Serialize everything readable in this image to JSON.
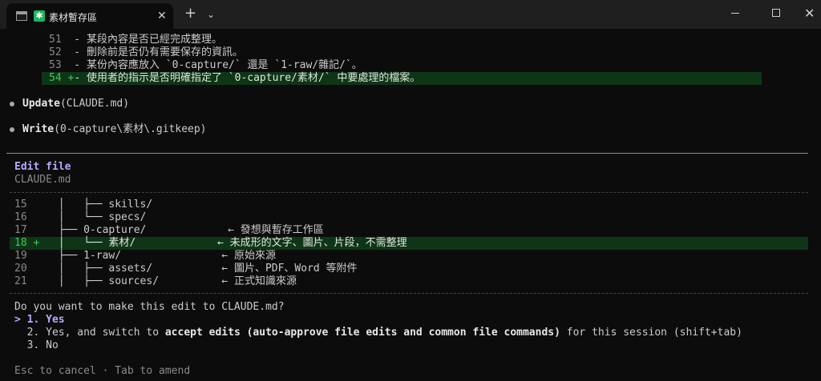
{
  "window": {
    "tab_title": "素材暫存區",
    "tab_badge": "✱",
    "tab_close": "✕",
    "new_tab": "+",
    "tab_dropdown": "⌄",
    "close_glyph": "✕"
  },
  "diff_top": [
    {
      "num": "51",
      "text": "  - 某段內容是否已經完成整理。"
    },
    {
      "num": "52",
      "text": "  - 刪除前是否仍有需要保存的資訊。"
    },
    {
      "num": "53",
      "text": "  - 某份內容應放入 `0-capture/` 還是 `1-raw/雜記/`。"
    },
    {
      "num": "54",
      "marker": "+",
      "text": "- 使用者的指示是否明確指定了 `0-capture/素材/` 中要處理的檔案。"
    }
  ],
  "actions": [
    {
      "tool": "Update",
      "args": "(CLAUDE.md)"
    },
    {
      "tool": "Write",
      "args": "(0-capture\\素材\\.gitkeep)"
    }
  ],
  "edit_panel": {
    "title": "Edit file",
    "filename": "CLAUDE.md",
    "lines": [
      {
        "num": "15",
        "marker": "",
        "text": "  │   ├── skills/"
      },
      {
        "num": "16",
        "marker": "",
        "text": "  │   └── specs/"
      },
      {
        "num": "17",
        "marker": "",
        "text": "  ├── 0-capture/             ← 發想與暫存工作區"
      },
      {
        "num": "18",
        "marker": "+",
        "text": "  │   └── 素材/             ← 未成形的文字、圖片、片段，不需整理"
      },
      {
        "num": "19",
        "marker": "",
        "text": "  ├── 1-raw/                ← 原始來源"
      },
      {
        "num": "20",
        "marker": "",
        "text": "  │   ├── assets/           ← 圖片、PDF、Word 等附件"
      },
      {
        "num": "21",
        "marker": "",
        "text": "  │   ├── sources/          ← 正式知識來源"
      }
    ]
  },
  "prompt": {
    "question": "Do you want to make this edit to CLAUDE.md?",
    "options": [
      {
        "prefix": "> 1. ",
        "label": "Yes"
      },
      {
        "prefix": "  2. ",
        "label_pre": "Yes, and switch to ",
        "label_bold": "accept edits (auto-approve file edits and common file commands)",
        "label_post": " for this session (shift+tab)"
      },
      {
        "prefix": "  3. ",
        "label": "No"
      }
    ],
    "hint": "Esc to cancel · Tab to amend"
  },
  "colors": {
    "background": "#0c0c0c",
    "accent_purple": "#b9a8ff",
    "added_bg": "#0f3517",
    "added_num": "#3fc85f"
  }
}
